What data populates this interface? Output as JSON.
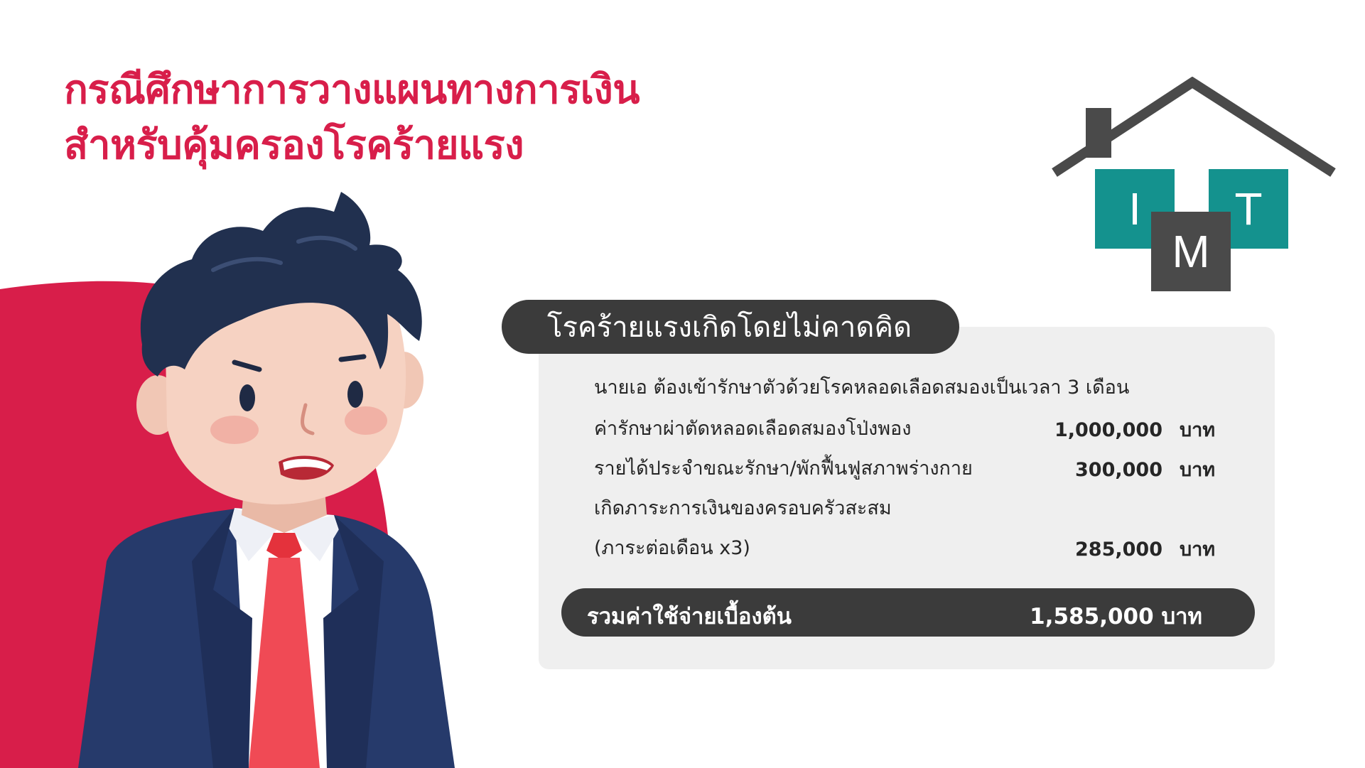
{
  "title": {
    "line1": "กรณีศึกษาการวางแผนทางการเงิน",
    "line2": "สำหรับคุ้มครองโรคร้ายแรง"
  },
  "logo": {
    "letter_i": "I",
    "letter_m": "M",
    "letter_t": "T"
  },
  "colors": {
    "accent": "#d81e4a",
    "dark": "#3b3b3b",
    "teal": "#14928e",
    "logo_gray": "#4a4a4a",
    "card": "#efefef"
  },
  "card": {
    "header": "โรคร้ายแรงเกิดโดยไม่คาดคิด",
    "intro": "นายเอ ต้องเข้ารักษาตัวด้วยโรคหลอดเลือดสมองเป็นเวลา 3 เดือน",
    "items": [
      {
        "label": "ค่ารักษาผ่าตัดหลอดเลือดสมองโป่งพอง",
        "amount": "1,000,000",
        "unit": "บาท"
      },
      {
        "label": "รายได้ประจำขณะรักษา/พักฟื้นฟูสภาพร่างกาย",
        "amount": "300,000",
        "unit": "บาท"
      },
      {
        "label": "เกิดภาระการเงินของครอบครัวสะสม"
      },
      {
        "label": "(ภาระต่อเดือน x3)",
        "amount": "285,000",
        "unit": "บาท"
      }
    ],
    "total_label": "รวมค่าใช้จ่ายเบื้องต้น",
    "total_value": "1,585,000 บาท"
  }
}
